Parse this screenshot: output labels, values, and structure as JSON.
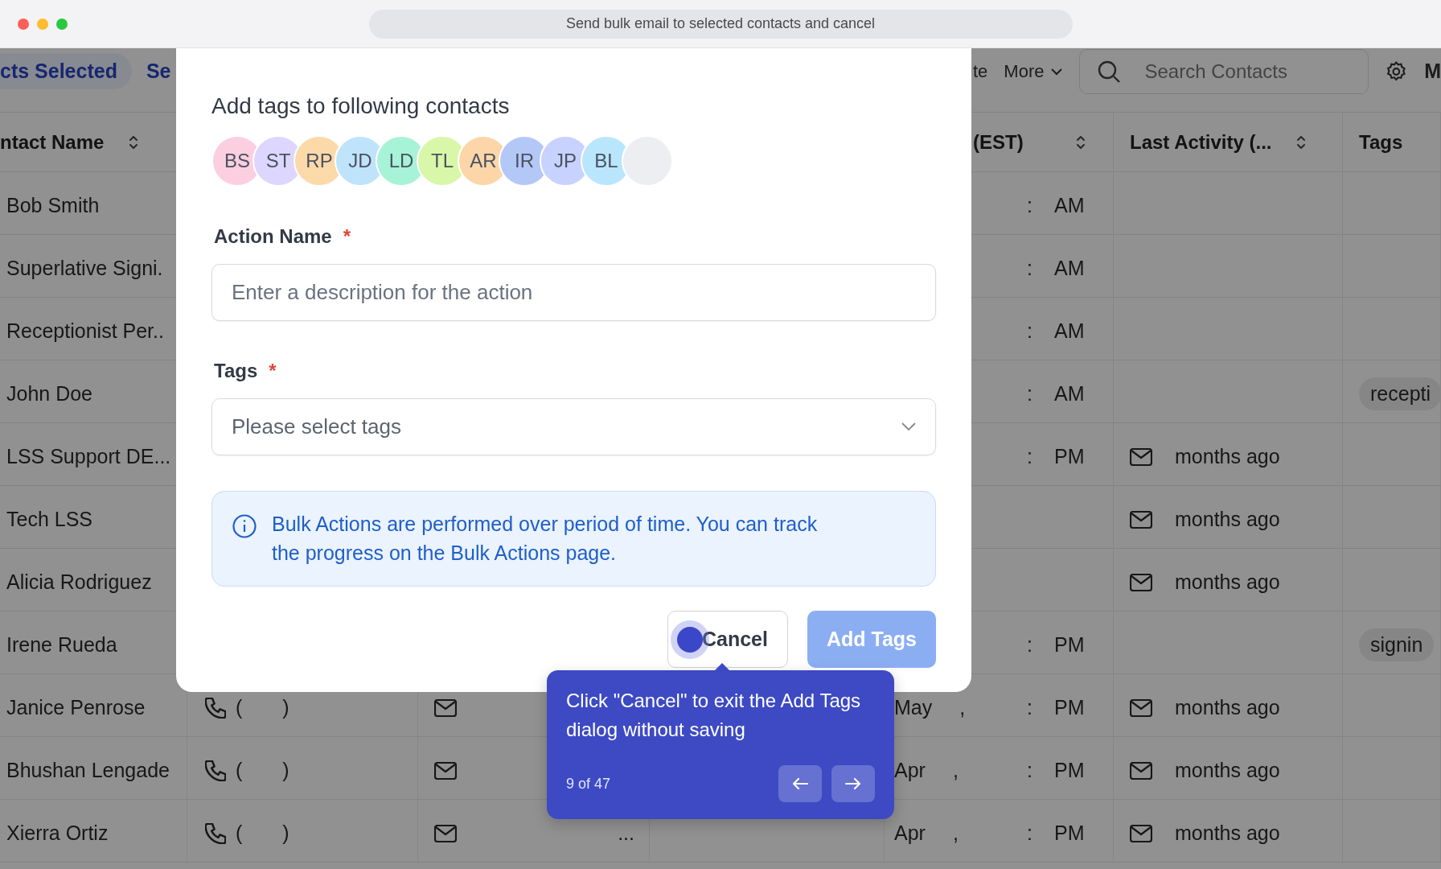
{
  "window": {
    "title": "Send bulk email to selected contacts and cancel"
  },
  "toolbar": {
    "selection": "cts Selected",
    "left_action": "Se",
    "right_action": "te",
    "more": "More",
    "search": {
      "placeholder": "Search Contacts"
    },
    "settings_label": "M"
  },
  "table": {
    "columns": [
      {
        "label": "ntact Name",
        "kind": "name"
      },
      {
        "label": "(EST)",
        "kind": "date"
      },
      {
        "label": "Last Activity (...",
        "kind": "activity"
      },
      {
        "label": "Tags",
        "kind": "tags"
      }
    ],
    "rows": [
      {
        "name": "Bob Smith",
        "time": [
          ":",
          "AM"
        ]
      },
      {
        "name": "Superlative Signi.",
        "time": [
          ":",
          "AM"
        ]
      },
      {
        "name": "Receptionist Per..",
        "time": [
          ":",
          "AM"
        ]
      },
      {
        "name": "John Doe",
        "time": [
          ":",
          "AM"
        ],
        "tag": "recepti"
      },
      {
        "name": "LSS Support DE...",
        "time": [
          ":",
          "PM"
        ],
        "activity": "months ago"
      },
      {
        "name": "Tech LSS",
        "activity": "months ago"
      },
      {
        "name": "Alicia Rodriguez",
        "activity": "months ago"
      },
      {
        "name": "Irene Rueda",
        "time": [
          ":",
          "PM"
        ],
        "tag": "signin"
      },
      {
        "name": "Janice Penrose",
        "phone": [
          "(",
          ")"
        ],
        "email": {},
        "date": [
          "May",
          ","
        ],
        "time": [
          ":",
          "PM"
        ],
        "activity": "months ago"
      },
      {
        "name": "Bhushan Lengade",
        "phone": [
          "(",
          ")"
        ],
        "email": {},
        "date": [
          "Apr",
          ","
        ],
        "time": [
          ":",
          "PM"
        ],
        "activity": "months ago"
      },
      {
        "name": "Xierra Ortiz",
        "phone": [
          "(",
          ")"
        ],
        "email": {
          "text": "..."
        },
        "date": [
          "Apr",
          ","
        ],
        "time": [
          ":",
          "PM"
        ],
        "activity": "months ago"
      }
    ]
  },
  "dialog": {
    "title": "Add tags to following contacts",
    "contacts": [
      {
        "initials": "BS",
        "color": "#fbcfe0"
      },
      {
        "initials": "ST",
        "color": "#ddd6fe"
      },
      {
        "initials": "RP",
        "color": "#fbd9a8"
      },
      {
        "initials": "JD",
        "color": "#bfe3fa"
      },
      {
        "initials": "LD",
        "color": "#a7f3d8"
      },
      {
        "initials": "TL",
        "color": "#d9f7a8"
      },
      {
        "initials": "AR",
        "color": "#fcd6a8"
      },
      {
        "initials": "IR",
        "color": "#b4c8f8"
      },
      {
        "initials": "JP",
        "color": "#c7d2fe"
      },
      {
        "initials": "BL",
        "color": "#bae6fd"
      },
      {
        "color": "#eceef2"
      }
    ],
    "fields": [
      {
        "label": "Action Name",
        "required_mark": "*",
        "kind": "text",
        "placeholder": "Enter a description for the action"
      },
      {
        "label": "Tags",
        "required_mark": "*",
        "kind": "select",
        "placeholder": "Please select tags"
      }
    ],
    "info": "Bulk Actions are performed over period of time. You can track the progress on the Bulk Actions page.",
    "buttons": [
      {
        "label": "Cancel",
        "kind": "secondary",
        "disabled": false
      },
      {
        "label": "Add Tags",
        "kind": "primary",
        "disabled": true
      }
    ]
  },
  "tour": {
    "text": "Click \"Cancel\" to exit the Add Tags dialog without saving",
    "step": "9 of 47"
  }
}
